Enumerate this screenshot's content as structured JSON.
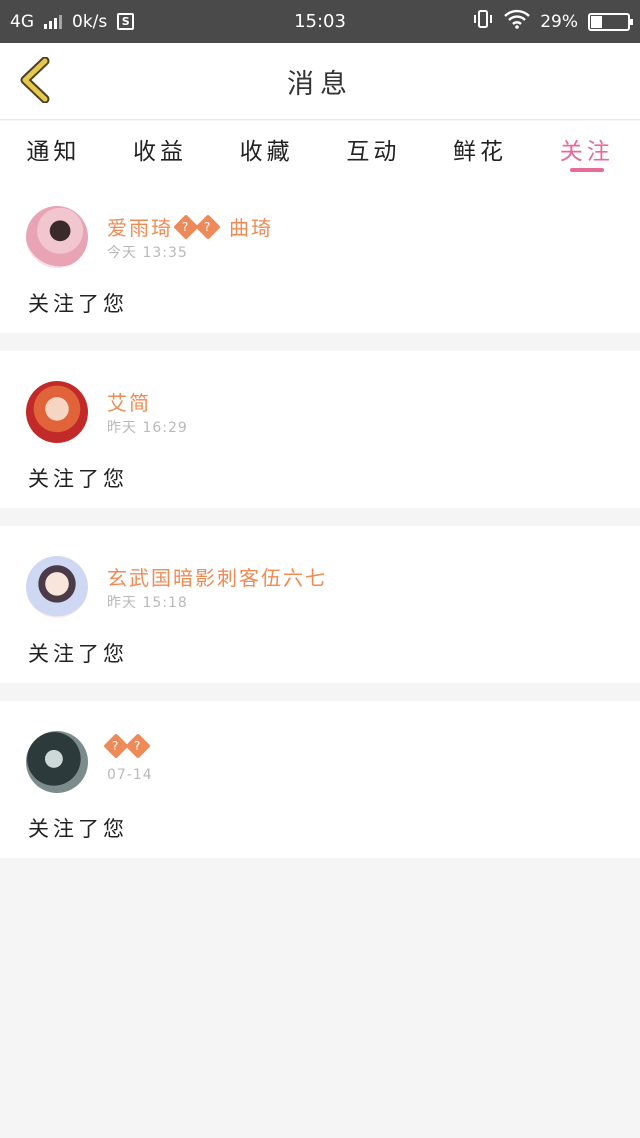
{
  "status_bar": {
    "network": "4G",
    "speed": "0k/s",
    "s_badge": "S",
    "time": "15:03",
    "battery": "29%"
  },
  "header": {
    "title": "消息"
  },
  "tabs": [
    {
      "label": "通知"
    },
    {
      "label": "收益"
    },
    {
      "label": "收藏"
    },
    {
      "label": "互动"
    },
    {
      "label": "鲜花"
    },
    {
      "label": "关注",
      "active": true
    }
  ],
  "messages": [
    {
      "name": "爱雨琦",
      "glyphs": [
        "?",
        "?"
      ],
      "suffix": "曲琦",
      "time": "今天 13:35",
      "text": "关注了您"
    },
    {
      "name": "艾简",
      "time": "昨天 16:29",
      "text": "关注了您"
    },
    {
      "name": "玄武国暗影刺客伍六七",
      "time": "昨天 15:18",
      "text": "关注了您"
    },
    {
      "glyphs": [
        "?",
        "?"
      ],
      "time": "07-14",
      "text": "关注了您"
    }
  ],
  "colors": {
    "accent": "#e86a9a",
    "name": "#f08a53",
    "status_bar_bg": "#4a4a4a",
    "back_icon": "#e6c94a"
  },
  "icons": {
    "back": "chevron-left-icon",
    "vibrate": "vibrate-icon",
    "wifi": "wifi-icon",
    "battery": "battery-icon"
  }
}
